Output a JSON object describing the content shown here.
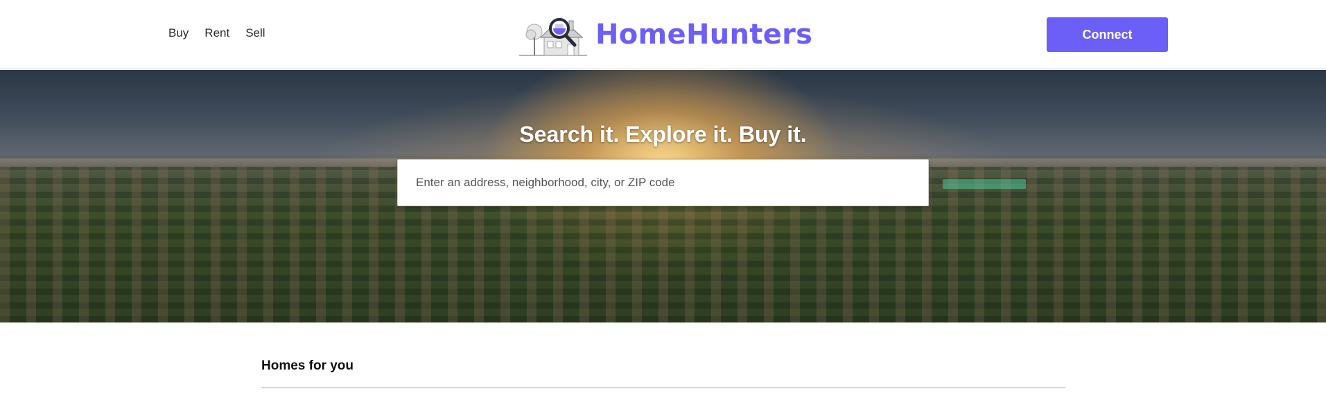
{
  "header": {
    "nav": [
      {
        "label": "Buy"
      },
      {
        "label": "Rent"
      },
      {
        "label": "Sell"
      }
    ],
    "brand": "HomeHunters",
    "connect_label": "Connect",
    "accent_color": "#6c5ff7"
  },
  "hero": {
    "headline": "Search it. Explore it. Buy it.",
    "search_placeholder": "Enter an address, neighborhood, city, or ZIP code",
    "search_value": ""
  },
  "section": {
    "title": "Homes for you"
  },
  "icons": {
    "logo": "house-magnifier-logo-icon"
  }
}
